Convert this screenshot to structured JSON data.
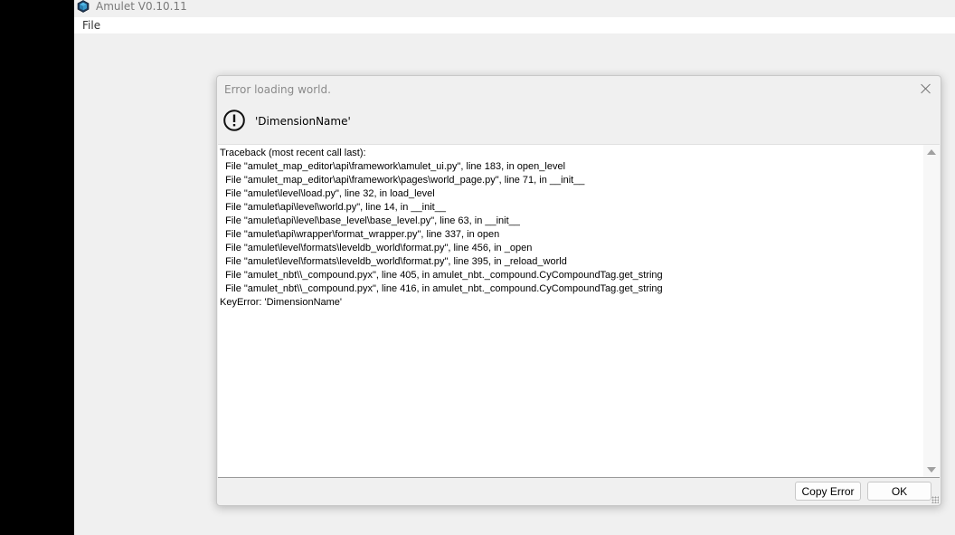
{
  "app": {
    "title": "Amulet V0.10.11",
    "icon": "amulet-cube-icon"
  },
  "menubar": {
    "file_label": "File"
  },
  "dialog": {
    "title": "Error loading world.",
    "message": "'DimensionName'",
    "icon": "exclamation-circle-icon",
    "traceback": "Traceback (most recent call last):\n  File \"amulet_map_editor\\api\\framework\\amulet_ui.py\", line 183, in open_level\n  File \"amulet_map_editor\\api\\framework\\pages\\world_page.py\", line 71, in __init__\n  File \"amulet\\level\\load.py\", line 32, in load_level\n  File \"amulet\\api\\level\\world.py\", line 14, in __init__\n  File \"amulet\\api\\level\\base_level\\base_level.py\", line 63, in __init__\n  File \"amulet\\api\\wrapper\\format_wrapper.py\", line 337, in open\n  File \"amulet\\level\\formats\\leveldb_world\\format.py\", line 456, in _open\n  File \"amulet\\level\\formats\\leveldb_world\\format.py\", line 395, in _reload_world\n  File \"amulet_nbt\\\\_compound.pyx\", line 405, in amulet_nbt._compound.CyCompoundTag.get_string\n  File \"amulet_nbt\\\\_compound.pyx\", line 416, in amulet_nbt._compound.CyCompoundTag.get_string\nKeyError: 'DimensionName'",
    "copy_error_label": "Copy Error",
    "ok_label": "OK"
  }
}
